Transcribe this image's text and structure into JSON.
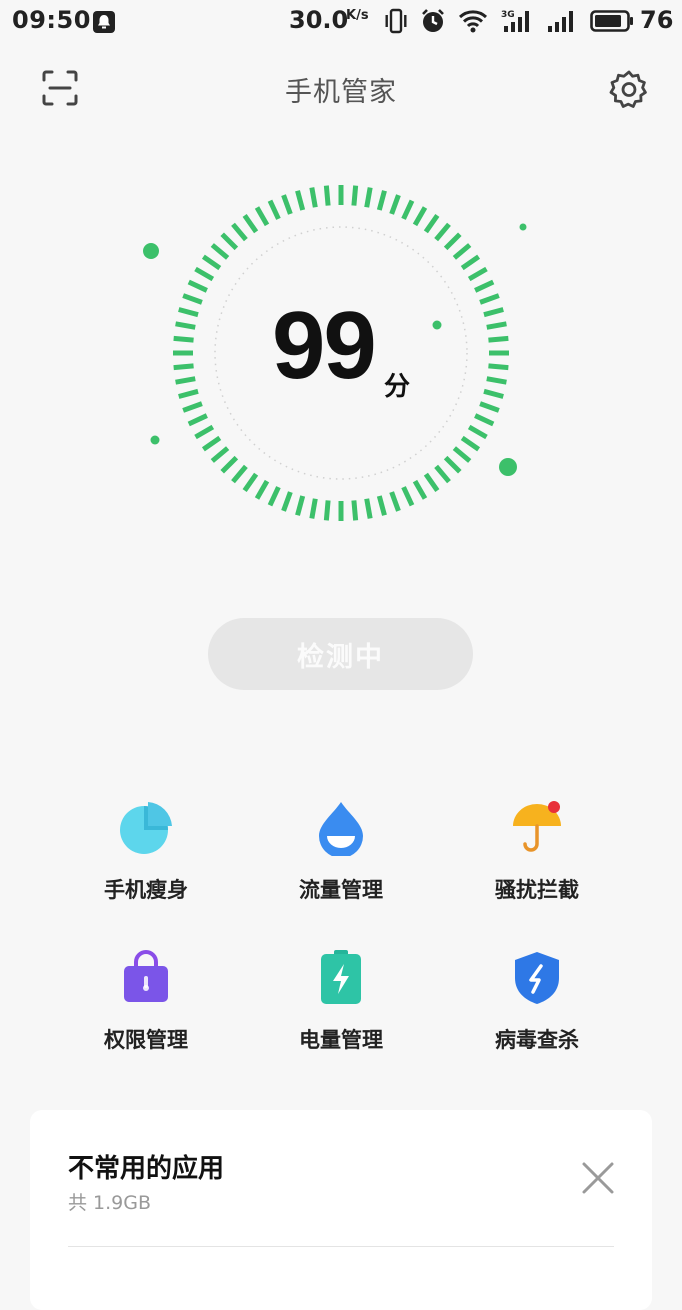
{
  "status_bar": {
    "time": "09:50",
    "network_speed": "30.0",
    "network_speed_unit": "K/s",
    "battery_level": "76",
    "icons": [
      "notification-icon",
      "vibrate-icon",
      "alarm-icon",
      "wifi-icon",
      "signal-3g-icon",
      "signal-icon",
      "battery-icon"
    ]
  },
  "header": {
    "title": "手机管家",
    "left_icon": "scan-icon",
    "right_icon": "gear-icon"
  },
  "score": {
    "value": "99",
    "unit": "分"
  },
  "detect_button": {
    "label": "检测中"
  },
  "tools": [
    {
      "label": "手机瘦身",
      "icon": "pie-chart-icon"
    },
    {
      "label": "流量管理",
      "icon": "water-drop-icon"
    },
    {
      "label": "骚扰拦截",
      "icon": "umbrella-icon"
    },
    {
      "label": "权限管理",
      "icon": "lock-bag-icon"
    },
    {
      "label": "电量管理",
      "icon": "battery-charge-icon"
    },
    {
      "label": "病毒查杀",
      "icon": "shield-icon"
    }
  ],
  "card": {
    "title": "不常用的应用",
    "subtitle": "共 1.9GB"
  },
  "colors": {
    "accent_green": "#3cc06a",
    "background": "#f7f7f7",
    "button_disabled": "#e6e6e6"
  }
}
